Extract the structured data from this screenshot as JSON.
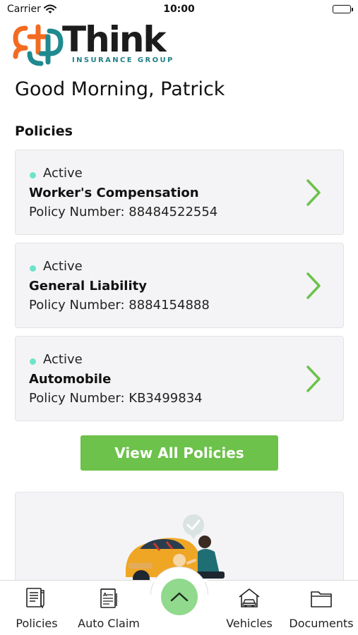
{
  "status_bar": {
    "carrier": "Carrier",
    "time": "10:00"
  },
  "logo": {
    "word": "Think",
    "subtitle": "INSURANCE GROUP"
  },
  "greeting": "Good Morning, Patrick",
  "policies_section": {
    "title": "Policies",
    "items": [
      {
        "status": "Active",
        "name": "Worker's Compensation",
        "number": "Policy Number: 88484522554"
      },
      {
        "status": "Active",
        "name": "General Liability",
        "number": "Policy Number: 8884154888"
      },
      {
        "status": "Active",
        "name": "Automobile",
        "number": "Policy Number: KB3499834"
      }
    ],
    "view_all_label": "View All Policies"
  },
  "tabbar": {
    "tabs": [
      {
        "label": "Policies",
        "icon": "policy-document-icon"
      },
      {
        "label": "Auto Claim",
        "icon": "claim-form-icon"
      },
      {
        "label": "Vehicles",
        "icon": "house-car-icon"
      },
      {
        "label": "Documents",
        "icon": "folder-icon"
      }
    ],
    "center_icon": "chevron-up-icon"
  },
  "colors": {
    "accent_green": "#6cc24a",
    "center_button": "#90d98d",
    "active_dot": "#6fe3c9",
    "logo_orange": "#f26b21",
    "logo_teal": "#1f8a8f"
  }
}
